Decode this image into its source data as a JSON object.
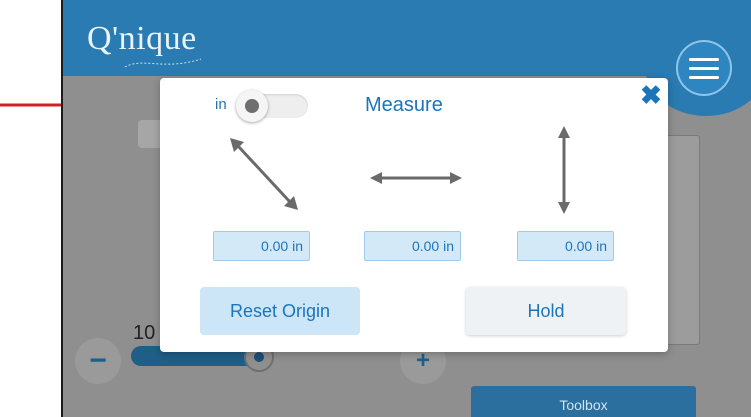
{
  "app": {
    "logo_text": "Q'nique"
  },
  "background": {
    "zoom_value": "10",
    "zoom_minus": "−",
    "zoom_plus": "+",
    "zoom_level_fraction": 0.95,
    "toolbox_label": "Toolbox"
  },
  "modal": {
    "title": "Measure",
    "unit_label": "in",
    "close_glyph": "✖",
    "fields": [
      {
        "name": "diagonal",
        "value": "0.00 in"
      },
      {
        "name": "horizontal",
        "value": "0.00 in"
      },
      {
        "name": "vertical",
        "value": "0.00 in"
      }
    ],
    "reset_label": "Reset Origin",
    "hold_label": "Hold"
  },
  "colors": {
    "brand_blue": "#2a7bb1",
    "accent_text": "#1b75bb",
    "annotation_red": "#d0202a"
  },
  "icons": {
    "menu": "hamburger-menu-icon",
    "close": "close-icon",
    "diagonal": "diagonal-arrow-icon",
    "horizontal": "horizontal-arrow-icon",
    "vertical": "vertical-arrow-icon"
  }
}
